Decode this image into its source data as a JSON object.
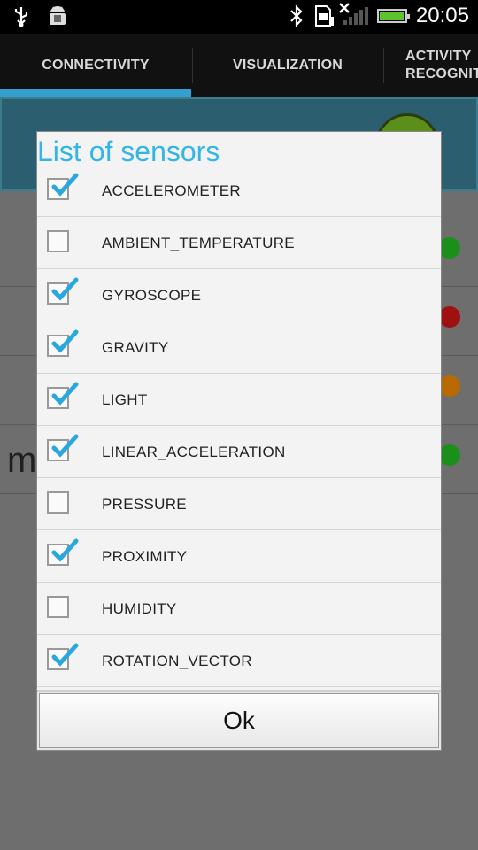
{
  "status_bar": {
    "time": "20:05",
    "icons": [
      "usb-icon",
      "android-debug-icon",
      "bluetooth-icon",
      "sd-card-icon",
      "no-signal-icon",
      "battery-icon"
    ]
  },
  "tabs": [
    {
      "label": "CONNECTIVITY",
      "selected": true
    },
    {
      "label": "VISUALIZATION",
      "selected": false
    },
    {
      "label": "ACTIVITY\nRECOGNIT",
      "selected": false
    }
  ],
  "dialog": {
    "title": "List of sensors",
    "sensors": [
      {
        "label": "ACCELEROMETER",
        "checked": true
      },
      {
        "label": "AMBIENT_TEMPERATURE",
        "checked": false
      },
      {
        "label": "GYROSCOPE",
        "checked": true
      },
      {
        "label": "GRAVITY",
        "checked": true
      },
      {
        "label": "LIGHT",
        "checked": true
      },
      {
        "label": "LINEAR_ACCELERATION",
        "checked": true
      },
      {
        "label": "PRESSURE",
        "checked": false
      },
      {
        "label": "PROXIMITY",
        "checked": true
      },
      {
        "label": "HUMIDITY",
        "checked": false
      },
      {
        "label": "ROTATION_VECTOR",
        "checked": true
      }
    ],
    "ok_label": "Ok"
  },
  "background": {
    "partial_text": "m",
    "status_colors": [
      "#1a8f1a",
      "#a01010",
      "#b86a00",
      "#1a8f1a"
    ]
  },
  "colors": {
    "accent": "#33b5e5",
    "tab_indicator": "#33a0d0",
    "check": "#2aa7de"
  }
}
